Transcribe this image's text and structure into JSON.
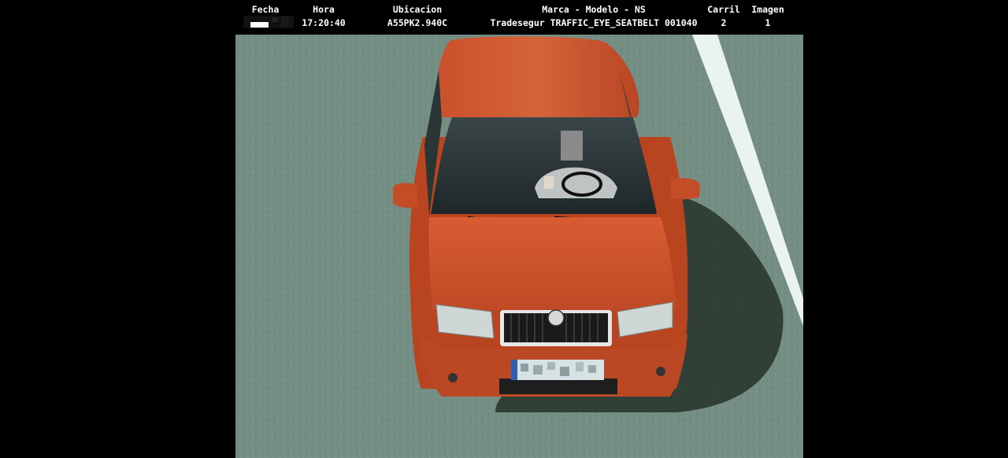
{
  "header": {
    "fecha": {
      "label": "Fecha",
      "value": ""
    },
    "hora": {
      "label": "Hora",
      "value": "17:20:40"
    },
    "ubicacion": {
      "label": "Ubicacion",
      "value": "A55PK2.940C"
    },
    "marca": {
      "label": "Marca - Modelo - NS",
      "value": "Tradesegur TRAFFIC_EYE_SEATBELT 001040"
    },
    "carril": {
      "label": "Carril",
      "value": "2"
    },
    "imagen": {
      "label": "Imagen",
      "value": "1"
    }
  },
  "scene": {
    "car_color": "#c8502a",
    "road_color": "#738c82",
    "lane_line_color": "#eef5f0"
  }
}
